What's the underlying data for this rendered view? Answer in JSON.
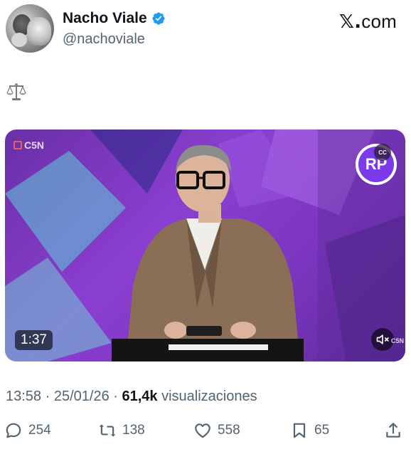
{
  "header": {
    "display_name": "Nacho Viale",
    "handle": "@nachoviale",
    "site_label": "com",
    "site_x": "𝕏."
  },
  "post": {
    "text_icon": "balance-scale-icon"
  },
  "video": {
    "channel_logo": "C5N",
    "corner_logo": "RP",
    "cc_label": "CC",
    "duration": "1:37",
    "watermark": "C5N"
  },
  "meta": {
    "time": "13:58",
    "sep1": " · ",
    "date": "25/01/26",
    "sep2": " · ",
    "views_count": "61,4k",
    "views_label": " visualizaciones"
  },
  "actions": {
    "replies": "254",
    "reposts": "138",
    "likes": "558",
    "bookmarks": "65"
  },
  "colors": {
    "verified": "#1d9bf0",
    "text_primary": "#0f1419",
    "text_secondary": "#536471",
    "video_purple": "#7a35bd"
  }
}
